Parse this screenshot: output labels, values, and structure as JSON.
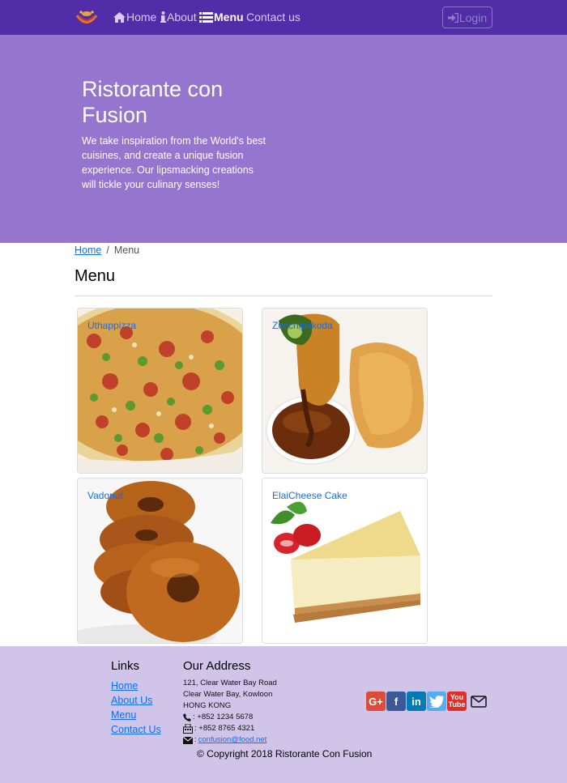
{
  "navbar": {
    "items": [
      {
        "label": "Home",
        "icon": "home-icon"
      },
      {
        "label": "About",
        "icon": "info-icon"
      },
      {
        "label": "Menu",
        "icon": "list-icon",
        "active": true
      },
      {
        "label": "Contact us"
      }
    ],
    "login_label": "Login"
  },
  "hero": {
    "title": "Ristorante con Fusion",
    "text": "We take inspiration from the World's best cuisines, and create a unique fusion experience. Our lipsmacking creations will tickle your culinary senses!"
  },
  "breadcrumb": {
    "home": "Home",
    "separator": "/",
    "current": "Menu"
  },
  "page": {
    "title": "Menu"
  },
  "dishes": [
    {
      "name": "Uthappizza"
    },
    {
      "name": "Zucchipakoda"
    },
    {
      "name": "Vadonut"
    },
    {
      "name": "ElaiCheese Cake"
    }
  ],
  "footer": {
    "links_title": "Links",
    "links": [
      "Home",
      "About Us",
      "Menu",
      "Contact Us"
    ],
    "address_title": "Our Address",
    "address_lines": [
      "121, Clear Water Bay Road",
      "Clear Water Bay, Kowloon",
      "HONG KONG"
    ],
    "phone": ": +852 1234 5678",
    "fax": ": +852 8765 4321",
    "email": "confusion@food.net",
    "email_prefix": ":",
    "copyright": "© Copyright 2018 Ristorante Con Fusion"
  },
  "colors": {
    "navbar": "#512da8",
    "jumbotron": "#9575cd",
    "footer": "#d1c4e9",
    "link": "#0d6efd"
  }
}
